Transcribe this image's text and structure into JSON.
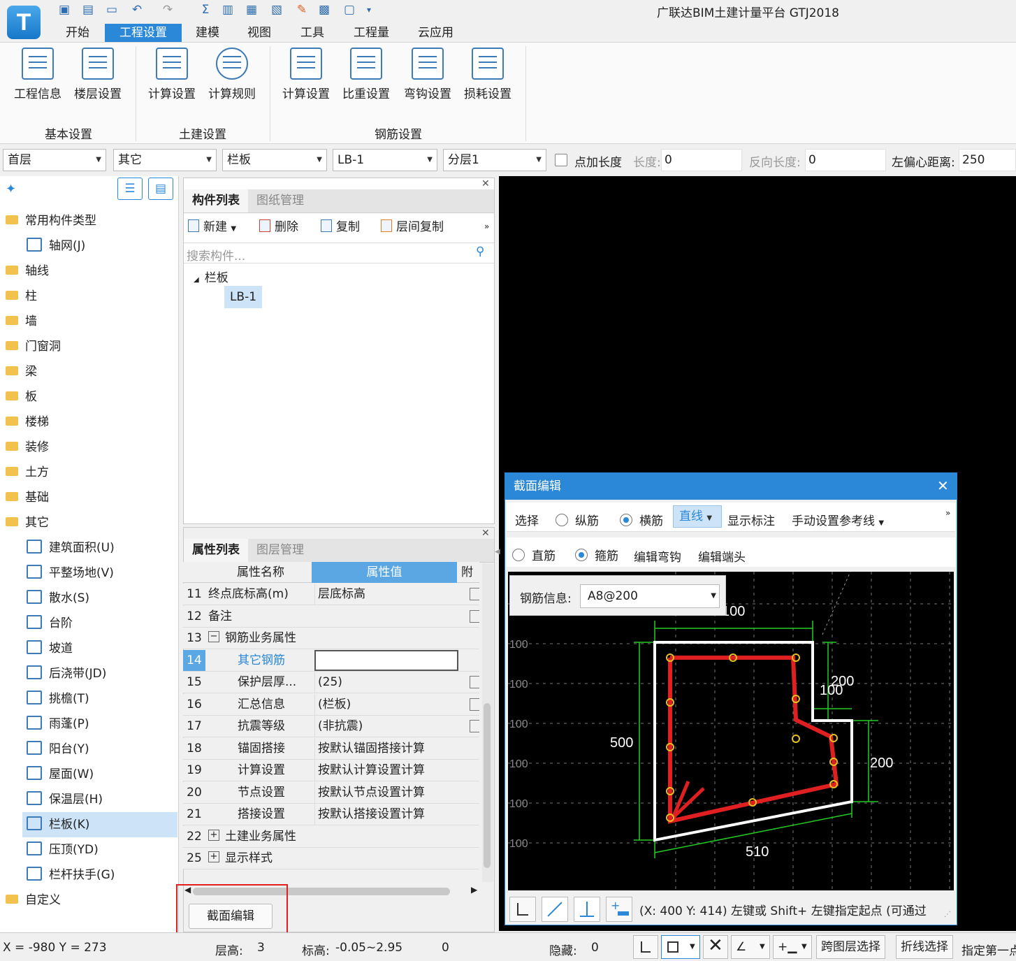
{
  "app": {
    "title": "广联达BIM土建计量平台 GTJ2018",
    "logo": "T"
  },
  "menu": [
    "开始",
    "工程设置",
    "建模",
    "视图",
    "工具",
    "工程量",
    "云应用"
  ],
  "ribbon": {
    "buttons": [
      "工程信息",
      "楼层设置",
      "计算设置",
      "计算规则",
      "计算设置",
      "比重设置",
      "弯钩设置",
      "损耗设置"
    ],
    "groups": [
      "基本设置",
      "土建设置",
      "钢筋设置"
    ]
  },
  "toolbar": {
    "floor": "首层",
    "category": "其它",
    "type": "栏板",
    "component": "LB-1",
    "layer": "分层1",
    "add_length_label": "点加长度",
    "length_label": "长度:",
    "length_value": "0",
    "reverse_label": "反向长度:",
    "reverse_value": "0",
    "offset_label": "左偏心距离:",
    "offset_value": "250"
  },
  "left_tree": {
    "items": [
      "常用构件类型",
      "轴网(J)",
      "轴线",
      "柱",
      "墙",
      "门窗洞",
      "梁",
      "板",
      "楼梯",
      "装修",
      "土方",
      "基础",
      "其它",
      "建筑面积(U)",
      "平整场地(V)",
      "散水(S)",
      "台阶",
      "坡道",
      "后浇带(JD)",
      "挑檐(T)",
      "雨蓬(P)",
      "阳台(Y)",
      "屋面(W)",
      "保温层(H)",
      "栏板(K)",
      "压顶(YD)",
      "栏杆扶手(G)",
      "自定义"
    ]
  },
  "component_panel": {
    "tabs": [
      "构件列表",
      "图纸管理"
    ],
    "actions": [
      "新建",
      "删除",
      "复制",
      "层间复制"
    ],
    "search_placeholder": "搜索构件...",
    "tree_root": "栏板",
    "tree_child": "LB-1"
  },
  "property_panel": {
    "tabs": [
      "属性列表",
      "图层管理"
    ],
    "headers": [
      "属性名称",
      "属性值",
      "附"
    ],
    "rows": [
      {
        "num": "11",
        "name": "终点底标高(m)",
        "value": "层底标高"
      },
      {
        "num": "12",
        "name": "备注",
        "value": ""
      },
      {
        "num": "13",
        "name": "钢筋业务属性",
        "value": ""
      },
      {
        "num": "14",
        "name": "其它钢筋",
        "value": ""
      },
      {
        "num": "15",
        "name": "保护层厚...",
        "value": "(25)"
      },
      {
        "num": "16",
        "name": "汇总信息",
        "value": "(栏板)"
      },
      {
        "num": "17",
        "name": "抗震等级",
        "value": "(非抗震)"
      },
      {
        "num": "18",
        "name": "锚固搭接",
        "value": "按默认锚固搭接计算"
      },
      {
        "num": "19",
        "name": "计算设置",
        "value": "按默认计算设置计算"
      },
      {
        "num": "20",
        "name": "节点设置",
        "value": "按默认节点设置计算"
      },
      {
        "num": "21",
        "name": "搭接设置",
        "value": "按默认搭接设置计算"
      },
      {
        "num": "22",
        "name": "土建业务属性",
        "value": ""
      },
      {
        "num": "25",
        "name": "显示样式",
        "value": ""
      }
    ],
    "section_edit_button": "截面编辑"
  },
  "dialog": {
    "title": "截面编辑",
    "close": "✕",
    "row1": [
      "选择",
      "纵筋",
      "横筋",
      "直线",
      "显示标注",
      "手动设置参考线"
    ],
    "row2": [
      "直筋",
      "箍筋",
      "编辑弯钩",
      "编辑端头"
    ],
    "rebar_label": "钢筋信息:",
    "rebar_value": "A8@200",
    "dims": [
      "100",
      "200",
      "100",
      "500",
      "200",
      "510"
    ],
    "grid_labels": [
      "100",
      "100",
      "100",
      "100",
      "100",
      "100",
      "100"
    ],
    "status": "(X: 400 Y: 414) 左键或 Shift+ 左键指定起点 (可通过"
  },
  "statusbar": {
    "coords": "X = -980 Y = 273",
    "floor_height_label": "层高:",
    "floor_height": "3",
    "elevation_label": "标高:",
    "elevation": "-0.05~2.95",
    "zero": "0",
    "hidden_label": "隐藏:",
    "hidden": "0",
    "btn1": "跨图层选择",
    "btn2": "折线选择",
    "hint": "指定第一点"
  },
  "colors": {
    "accent": "#2b88d8",
    "rebar": "#e02020",
    "dim": "#22cc22",
    "outline": "#ffffff",
    "point": "#e8c020"
  }
}
